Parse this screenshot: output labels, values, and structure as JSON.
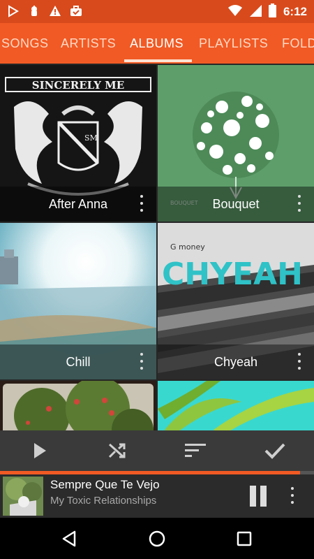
{
  "status_bar": {
    "time": "6:12",
    "icons": [
      "play-store-icon",
      "android-debug-icon",
      "warning-icon",
      "briefcase-icon",
      "wifi-icon",
      "signal-icon",
      "battery-icon"
    ]
  },
  "tabs": [
    {
      "label": "SONGS",
      "active": false
    },
    {
      "label": "ARTISTS",
      "active": false
    },
    {
      "label": "ALBUMS",
      "active": true
    },
    {
      "label": "PLAYLISTS",
      "active": false
    },
    {
      "label": "FOLD",
      "active": false
    }
  ],
  "albums": [
    {
      "name": "After Anna"
    },
    {
      "name": "Bouquet"
    },
    {
      "name": "Chill"
    },
    {
      "name": "Chyeah"
    },
    {
      "name": ""
    },
    {
      "name": ""
    }
  ],
  "album_art_text": {
    "after_anna_banner": "SINCERELY ME",
    "after_anna_crest": "SM",
    "bouquet_small": "BOUQUET",
    "chyeah_artist": "G money",
    "chyeah_title": "CHYEAH"
  },
  "actions": {
    "icons": [
      "play-icon",
      "shuffle-icon",
      "sort-icon",
      "check-icon"
    ]
  },
  "now_playing": {
    "title": "Sempre Que Te Vejo",
    "artist": "My Toxic Relationships",
    "progress": 0.955
  },
  "navigation": {
    "icons": [
      "back-icon",
      "home-icon",
      "recents-icon"
    ]
  },
  "colors": {
    "accent": "#f15a24",
    "status_bar": "#d84a1c"
  }
}
